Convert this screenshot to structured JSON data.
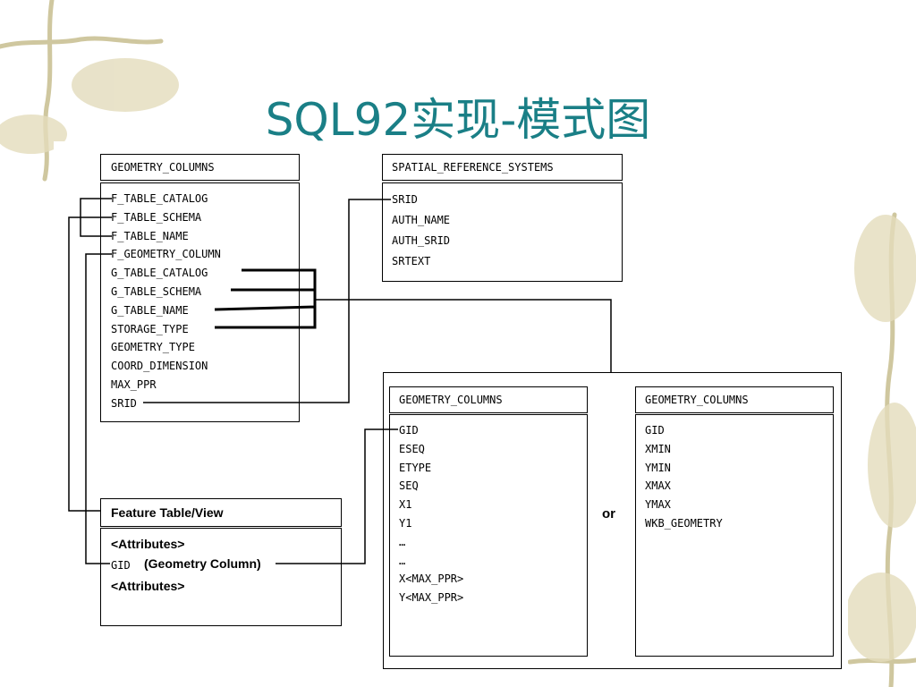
{
  "title": "SQL92实现-模式图",
  "geometry_columns": {
    "header": "GEOMETRY_COLUMNS",
    "fields": [
      "F_TABLE_CATALOG",
      "F_TABLE_SCHEMA",
      "F_TABLE_NAME",
      "F_GEOMETRY_COLUMN",
      "G_TABLE_CATALOG",
      "G_TABLE_SCHEMA",
      "G_TABLE_NAME",
      "STORAGE_TYPE",
      "GEOMETRY_TYPE",
      "COORD_DIMENSION",
      "MAX_PPR",
      "SRID"
    ]
  },
  "spatial_reference_systems": {
    "header": "SPATIAL_REFERENCE_SYSTEMS",
    "fields": [
      "SRID",
      "AUTH_NAME",
      "AUTH_SRID",
      "SRTEXT"
    ]
  },
  "feature_table": {
    "header": "Feature Table/View",
    "attributes_1": "<Attributes>",
    "gid": "GID",
    "gid_note": "(Geometry Column)",
    "attributes_2": "<Attributes>"
  },
  "normalized_geometry": {
    "header": "GEOMETRY_COLUMNS",
    "fields": [
      "GID",
      "ESEQ",
      "ETYPE",
      "SEQ",
      "X1",
      "Y1",
      "…",
      "…",
      "X<MAX_PPR>",
      "Y<MAX_PPR>"
    ]
  },
  "binary_geometry": {
    "header": "GEOMETRY_COLUMNS",
    "fields": [
      "GID",
      "XMIN",
      "YMIN",
      "XMAX",
      "YMAX",
      "WKB_GEOMETRY"
    ]
  },
  "or_label": "or",
  "colors": {
    "title": "#1a7f86",
    "line": "#000000",
    "background": "#ffffff"
  }
}
